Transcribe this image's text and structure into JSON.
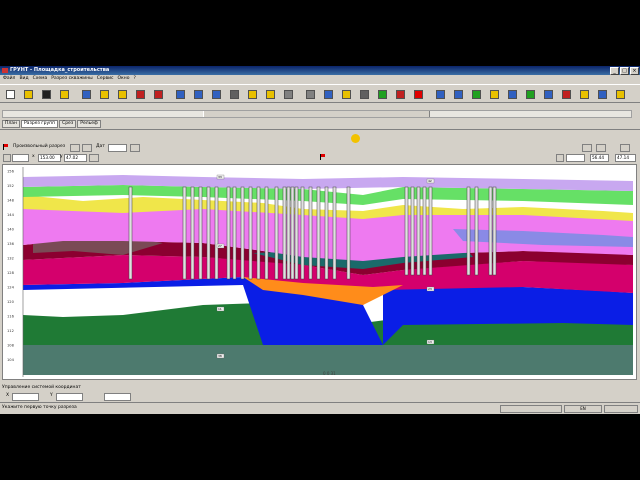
{
  "window": {
    "title": "ГРУНТ - Площадка_строительства",
    "min_label": "_",
    "max_label": "□",
    "close_label": "×"
  },
  "menu": [
    "Файл",
    "Вид",
    "Схема",
    "Разрез скважины",
    "Сервис",
    "Окно",
    "?"
  ],
  "tabs": [
    "План",
    "Разрез групп",
    "Срез",
    "Рельеф"
  ],
  "section": {
    "label": "Произвольный разрез",
    "field_a_label": "Дат",
    "field_a_value": ""
  },
  "controls": {
    "x_label": "x",
    "x_value": "153.00",
    "y_label": "y",
    "y_value": "47.02",
    "scale_value": "56.44",
    "end_value": "47.14"
  },
  "chart": {
    "y_ticks": [
      "156",
      "152",
      "148",
      "144",
      "140",
      "136",
      "132",
      "128",
      "124",
      "120",
      "116",
      "112",
      "108",
      "104"
    ],
    "x_caption": "0 0 31",
    "well_labels": [
      "33",
      "27",
      "11",
      "38",
      "42",
      "23",
      "13"
    ]
  },
  "status": {
    "caption": "Управление системой координат",
    "coord1_label": "X",
    "coord2_label": "Y",
    "hint": "Укажите первую точку разреза",
    "indicator": "EN"
  }
}
